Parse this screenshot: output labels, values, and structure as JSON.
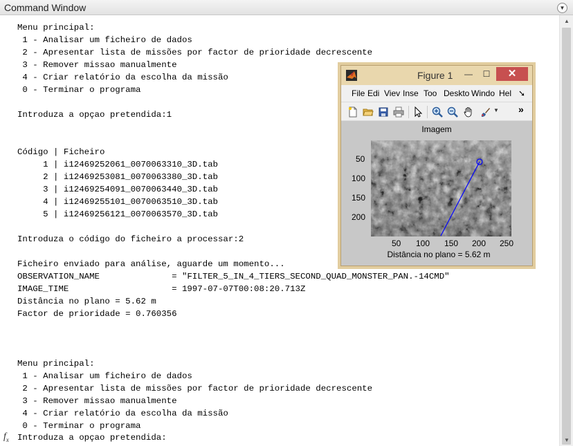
{
  "window": {
    "title": "Command Window"
  },
  "console_lines": [
    "Menu principal:",
    " 1 - Analisar um ficheiro de dados",
    " 2 - Apresentar lista de missões por factor de prioridade decrescente",
    " 3 - Remover missao manualmente",
    " 4 - Criar relatório da escolha da missão",
    " 0 - Terminar o programa",
    "",
    "Introduza a opçao pretendida:1",
    "",
    "",
    "Código | Ficheiro",
    "     1 | i12469252061_0070063310_3D.tab",
    "     2 | i12469253081_0070063380_3D.tab",
    "     3 | i12469254091_0070063440_3D.tab",
    "     4 | i12469255101_0070063510_3D.tab",
    "     5 | i12469256121_0070063570_3D.tab",
    "",
    "Introduza o código do ficheiro a processar:2",
    "",
    "Ficheiro enviado para análise, aguarde um momento...",
    "OBSERVATION_NAME              = \"FILTER_5_IN_4_TIERS_SECOND_QUAD_MONSTER_PAN.-14CMD\"",
    "IMAGE_TIME                    = 1997-07-07T00:08:20.713Z",
    "Distância no plano = 5.62 m",
    "Factor de prioridade = 0.760356",
    "",
    "",
    "",
    "Menu principal:",
    " 1 - Analisar um ficheiro de dados",
    " 2 - Apresentar lista de missões por factor de prioridade decrescente",
    " 3 - Remover missao manualmente",
    " 4 - Criar relatório da escolha da missão",
    " 0 - Terminar o programa"
  ],
  "prompt": {
    "fx": "fx",
    "text": "Introduza a opçao pretendida:"
  },
  "figure": {
    "title": "Figure 1",
    "menu": [
      "File",
      "Edi",
      "Viev",
      "Inse",
      "Too",
      "Deskto",
      "Windo",
      "Hel"
    ],
    "more_glyph": "»",
    "icons": [
      "new-file-icon",
      "open-folder-icon",
      "save-icon",
      "print-icon",
      "pointer-icon",
      "zoom-in-icon",
      "zoom-out-icon",
      "pan-hand-icon",
      "data-brush-icon"
    ],
    "axes": {
      "title": "Imagem",
      "xlabel": "Distância no plano = 5.62 m",
      "xticks": [
        "50",
        "100",
        "150",
        "200",
        "250"
      ],
      "yticks": [
        "50",
        "100",
        "150",
        "200"
      ]
    },
    "colors": {
      "line": "#0000ff",
      "titlebar": "#e9d7ad",
      "close": "#c75050"
    }
  }
}
